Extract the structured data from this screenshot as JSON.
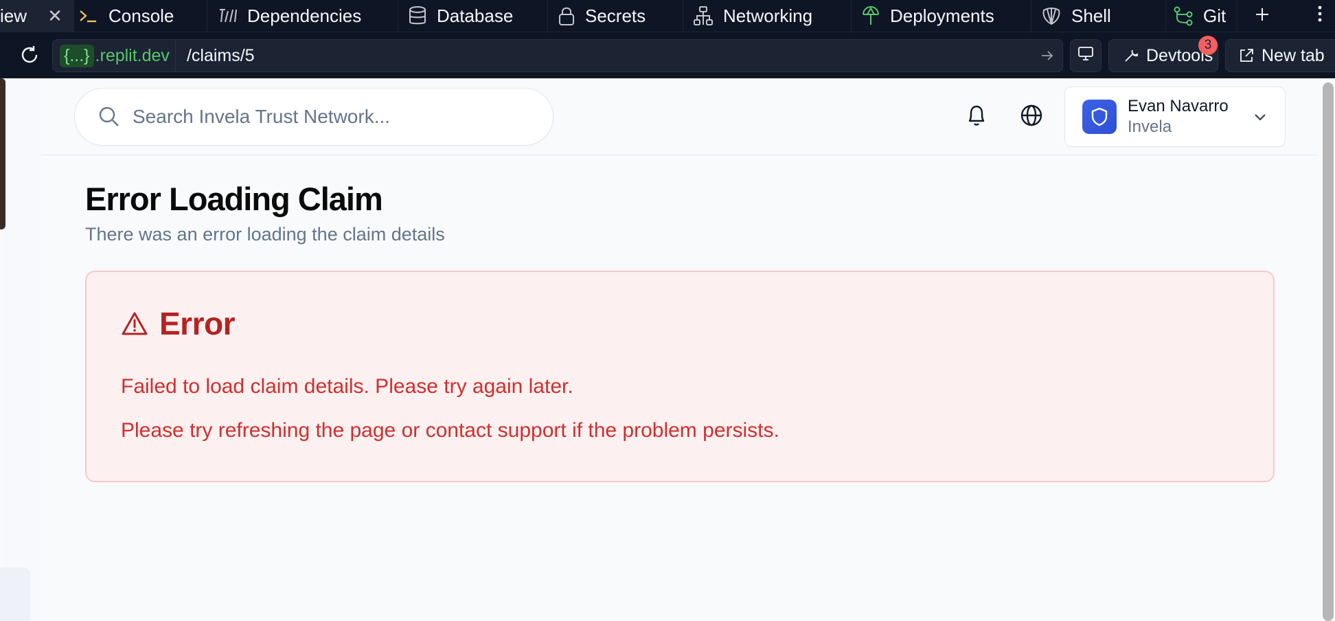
{
  "tabs": {
    "preview_partial": "iew",
    "items": [
      {
        "label": "Console",
        "icon": "console-icon"
      },
      {
        "label": "Dependencies",
        "icon": "dependencies-icon"
      },
      {
        "label": "Database",
        "icon": "database-icon"
      },
      {
        "label": "Secrets",
        "icon": "lock-icon"
      },
      {
        "label": "Networking",
        "icon": "network-icon"
      },
      {
        "label": "Deployments",
        "icon": "deployments-icon"
      },
      {
        "label": "Shell",
        "icon": "shell-icon"
      },
      {
        "label": "Git",
        "icon": "git-icon"
      }
    ]
  },
  "address": {
    "domain_chip": "{...}",
    "domain_rest": ".replit.dev",
    "path": "/claims/5",
    "devtools_label": "Devtools",
    "devtools_badge": "3",
    "new_tab_label": "New tab"
  },
  "header": {
    "search_placeholder": "Search Invela Trust Network...",
    "user_name": "Evan Navarro",
    "user_org": "Invela"
  },
  "page": {
    "title": "Error Loading Claim",
    "subtitle": "There was an error loading the claim details"
  },
  "error": {
    "title": "Error",
    "message": "Failed to load claim details. Please try again later.",
    "hint": "Please try refreshing the page or contact support if the problem persists."
  },
  "colors": {
    "chrome_bg": "#0e1525",
    "error_bg": "#fdf0f0",
    "error_text": "#cf2f2f",
    "accent": "#3b63e6",
    "domain_green": "#58c76b"
  }
}
